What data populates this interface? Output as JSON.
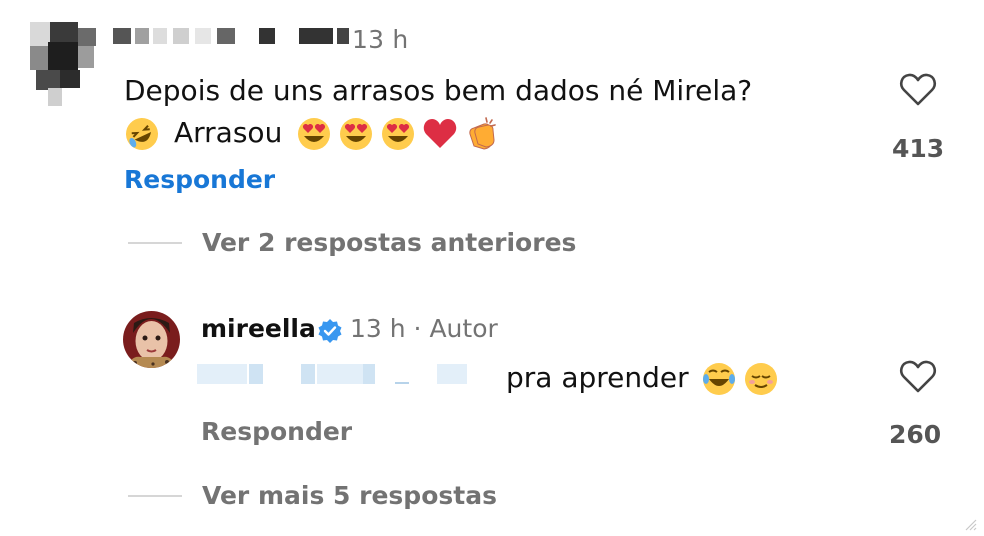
{
  "comment": {
    "time": "13 h",
    "text_line1": "Depois de uns arrasos bem dados né Mirela?",
    "text_line2_word": "Arrasou",
    "emojis": [
      "rolling-on-floor-laughing",
      "heart-eyes",
      "heart-eyes",
      "heart-eyes",
      "red-heart",
      "clapping-hands"
    ],
    "reply_label": "Responder",
    "likes": "413",
    "view_previous": "Ver 2 respostas anteriores"
  },
  "reply": {
    "username": "mireella",
    "time": "13 h · Autor",
    "text": "pra aprender",
    "emojis": [
      "tears-of-joy",
      "relieved-face"
    ],
    "reply_label": "Responder",
    "likes": "260",
    "view_more": "Ver mais 5 respostas"
  },
  "colors": {
    "link_blue": "#1877d6",
    "muted_gray": "#737373",
    "verified_blue": "#3897f0"
  }
}
